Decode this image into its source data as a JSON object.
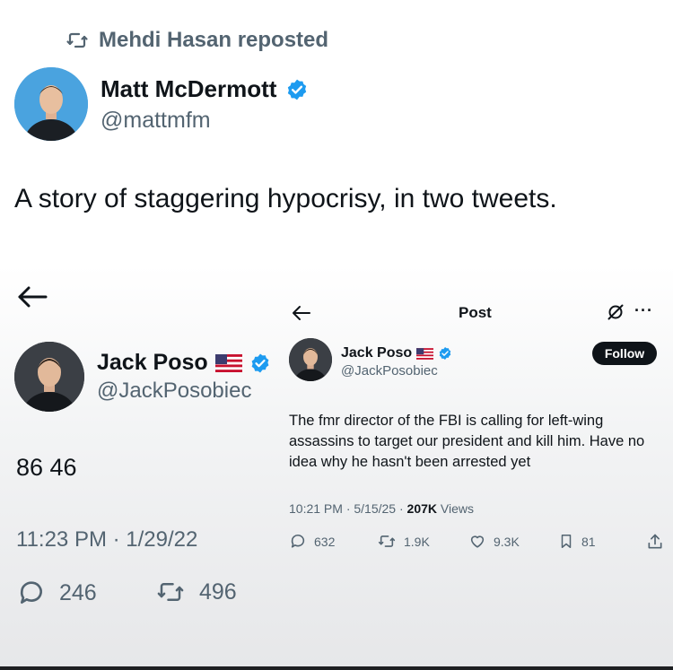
{
  "repost": {
    "text": "Mehdi Hasan reposted",
    "icon": "retweet-icon"
  },
  "author": {
    "name": "Matt McDermott",
    "handle": "@mattmfm",
    "verified": true
  },
  "tweet_text": "A story of staggering hypocrisy, in two tweets.",
  "left_tweet": {
    "name": "Jack Poso",
    "flag": "us-flag-icon",
    "handle": "@JackPosobiec",
    "body": "86 46",
    "time": "11:23 PM · 1/29/22",
    "replies": "246",
    "retweets": "496"
  },
  "right_tweet": {
    "header_title": "Post",
    "more_label": "···",
    "name": "Jack Poso",
    "handle": "@JackPosobiec",
    "follow_label": "Follow",
    "body": "The fmr director of the FBI is calling for left-wing assassins to target our president and kill him. Have no idea why he hasn't been arrested yet",
    "time": "10:21 PM · 5/15/25 · ",
    "views_count": "207K",
    "views_label": " Views",
    "replies": "632",
    "retweets": "1.9K",
    "likes": "9.3K",
    "bookmarks": "81"
  },
  "colors": {
    "verified": "#1d9bf0",
    "secondary_text": "#536471",
    "primary_text": "#0f1419"
  }
}
